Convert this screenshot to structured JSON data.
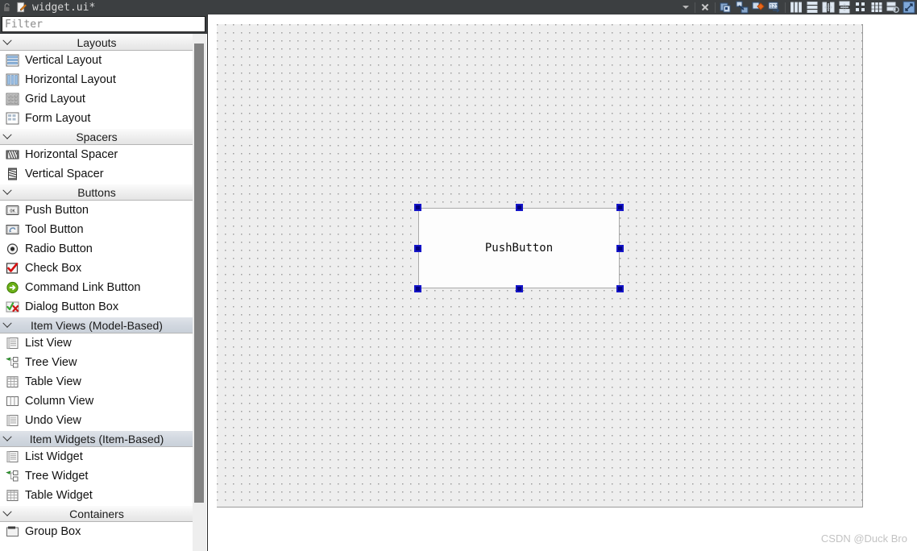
{
  "window": {
    "title": "widget.ui*",
    "lock_icon": "unlock-icon",
    "file_icon": "edit-document-icon",
    "dropdown_icon": "chevron-down-icon",
    "close_icon": "close-icon"
  },
  "toolbar": {
    "buttons": [
      {
        "name": "edit-widgets-icon",
        "label": "Edit Widgets"
      },
      {
        "name": "edit-signals-slots-icon",
        "label": "Edit Signals/Slots"
      },
      {
        "name": "edit-buddies-icon",
        "label": "Edit Buddies"
      },
      {
        "name": "edit-tab-order-icon",
        "label": "Edit Tab Order"
      },
      {
        "name": "layout-horizontally-icon",
        "label": "Lay Out Horizontally"
      },
      {
        "name": "layout-vertically-icon",
        "label": "Lay Out Vertically"
      },
      {
        "name": "layout-splitter-h-icon",
        "label": "Lay Out Horizontally in Splitter"
      },
      {
        "name": "layout-splitter-v-icon",
        "label": "Lay Out Vertically in Splitter"
      },
      {
        "name": "layout-form-icon",
        "label": "Lay Out in a Form Layout"
      },
      {
        "name": "layout-grid-icon",
        "label": "Lay Out in a Grid"
      },
      {
        "name": "break-layout-icon",
        "label": "Break Layout"
      },
      {
        "name": "adjust-size-icon",
        "label": "Adjust Size"
      }
    ]
  },
  "sidebar": {
    "filter": {
      "value": "",
      "placeholder": "Filter"
    },
    "groups": [
      {
        "title": "Layouts",
        "selected": false,
        "items": [
          {
            "label": "Vertical Layout",
            "icon": "vertical-layout-icon"
          },
          {
            "label": "Horizontal Layout",
            "icon": "horizontal-layout-icon"
          },
          {
            "label": "Grid Layout",
            "icon": "grid-layout-icon"
          },
          {
            "label": "Form Layout",
            "icon": "form-layout-icon"
          }
        ]
      },
      {
        "title": "Spacers",
        "selected": false,
        "items": [
          {
            "label": "Horizontal Spacer",
            "icon": "horizontal-spacer-icon"
          },
          {
            "label": "Vertical Spacer",
            "icon": "vertical-spacer-icon"
          }
        ]
      },
      {
        "title": "Buttons",
        "selected": false,
        "items": [
          {
            "label": "Push Button",
            "icon": "push-button-icon"
          },
          {
            "label": "Tool Button",
            "icon": "tool-button-icon"
          },
          {
            "label": "Radio Button",
            "icon": "radio-button-icon"
          },
          {
            "label": "Check Box",
            "icon": "check-box-icon"
          },
          {
            "label": "Command Link Button",
            "icon": "command-link-button-icon"
          },
          {
            "label": "Dialog Button Box",
            "icon": "dialog-button-box-icon"
          }
        ]
      },
      {
        "title": "Item Views (Model-Based)",
        "selected": true,
        "items": [
          {
            "label": "List View",
            "icon": "list-view-icon"
          },
          {
            "label": "Tree View",
            "icon": "tree-view-icon"
          },
          {
            "label": "Table View",
            "icon": "table-view-icon"
          },
          {
            "label": "Column View",
            "icon": "column-view-icon"
          },
          {
            "label": "Undo View",
            "icon": "undo-view-icon"
          }
        ]
      },
      {
        "title": "Item Widgets (Item-Based)",
        "selected": true,
        "items": [
          {
            "label": "List Widget",
            "icon": "list-widget-icon"
          },
          {
            "label": "Tree Widget",
            "icon": "tree-widget-icon"
          },
          {
            "label": "Table Widget",
            "icon": "table-widget-icon"
          }
        ]
      },
      {
        "title": "Containers",
        "selected": false,
        "items": [
          {
            "label": "Group Box",
            "icon": "group-box-icon"
          }
        ]
      }
    ]
  },
  "canvas": {
    "widgets": [
      {
        "type": "push-button",
        "text": "PushButton",
        "selected": true
      }
    ],
    "handle_color": "#000080",
    "grid_color": "#9e9e9e",
    "form_background": "#eeeeee"
  },
  "watermark": {
    "text": "CSDN @Duck Bro"
  }
}
